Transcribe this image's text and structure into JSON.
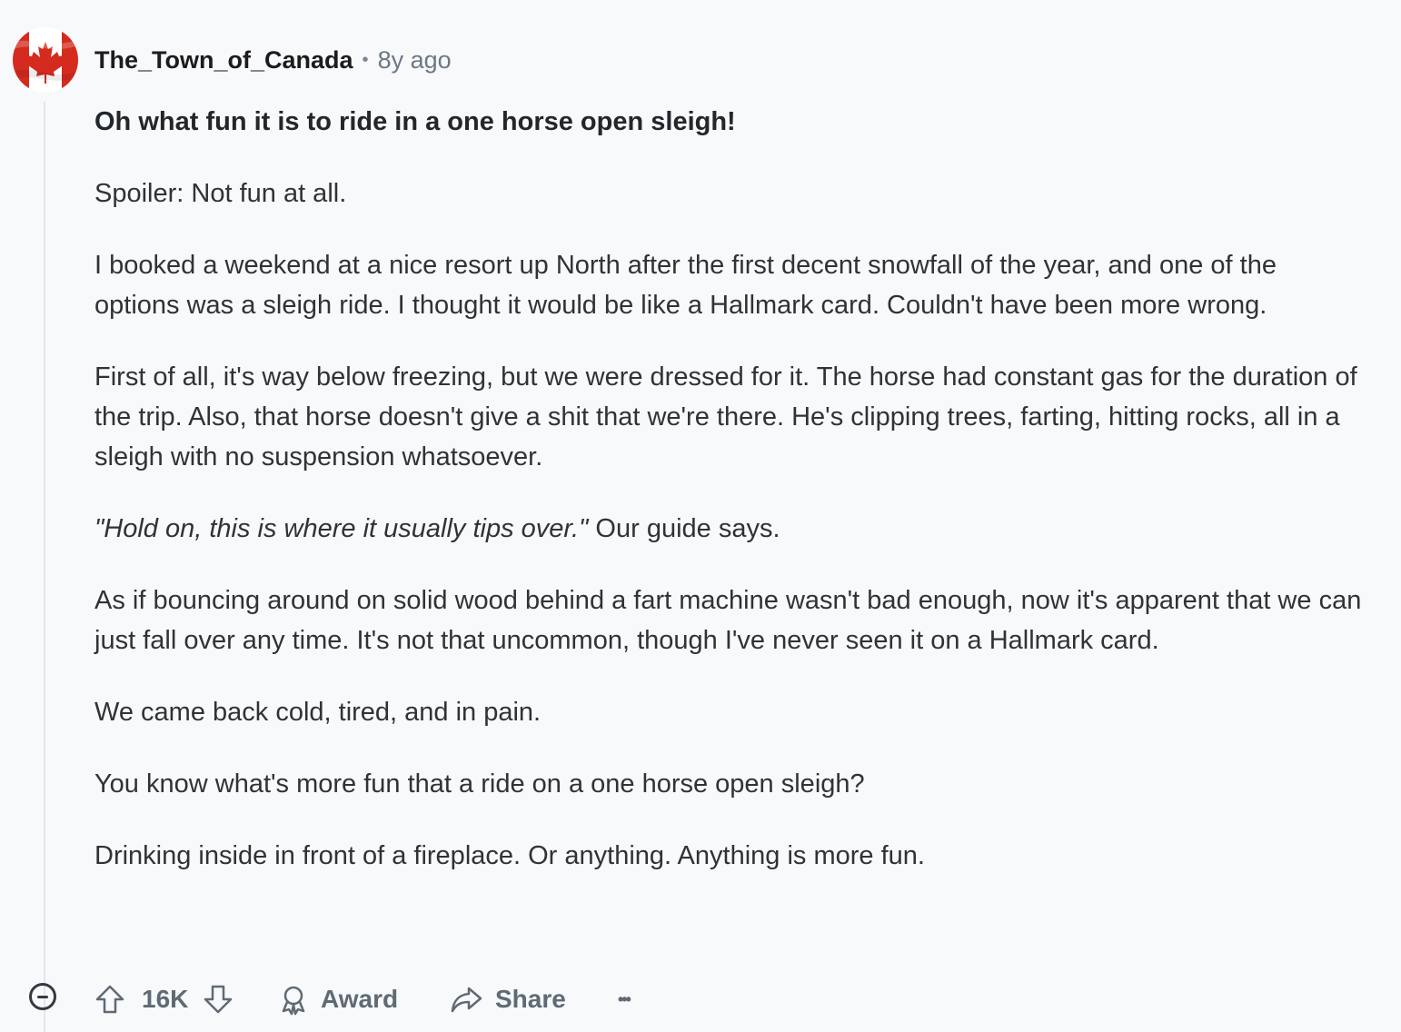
{
  "comment": {
    "username": "The_Town_of_Canada",
    "separator": "•",
    "timestamp": "8y ago",
    "avatar": {
      "icon": "canada-flag-icon",
      "colors": {
        "red": "#d52b1e",
        "white": "#ffffff"
      }
    },
    "body": {
      "heading": "Oh what fun it is to ride in a one horse open sleigh!",
      "p1": "Spoiler: Not fun at all.",
      "p2": "I booked a weekend at a nice resort up North after the first decent snowfall of the year, and one of the options was a sleigh ride. I thought it would be like a Hallmark card. Couldn't have been more wrong.",
      "p3": "First of all, it's way below freezing, but we were dressed for it. The horse had constant gas for the duration of the trip. Also, that horse doesn't give a shit that we're there. He's clipping trees, farting, hitting rocks, all in a sleigh with no suspension whatsoever.",
      "p4_quote": "\"Hold on, this is where it usually tips over.\"",
      "p4_rest": " Our guide says.",
      "p5": "As if bouncing around on solid wood behind a fart machine wasn't bad enough, now it's apparent that we can just fall over any time. It's not that uncommon, though I've never seen it on a Hallmark card.",
      "p6": "We came back cold, tired, and in pain.",
      "p7": "You know what's more fun that a ride on a one horse open sleigh?",
      "p8": "Drinking inside in front of a fireplace. Or anything. Anything is more fun."
    },
    "actions": {
      "score": "16K",
      "award_label": "Award",
      "share_label": "Share",
      "more_label": "•••"
    }
  }
}
